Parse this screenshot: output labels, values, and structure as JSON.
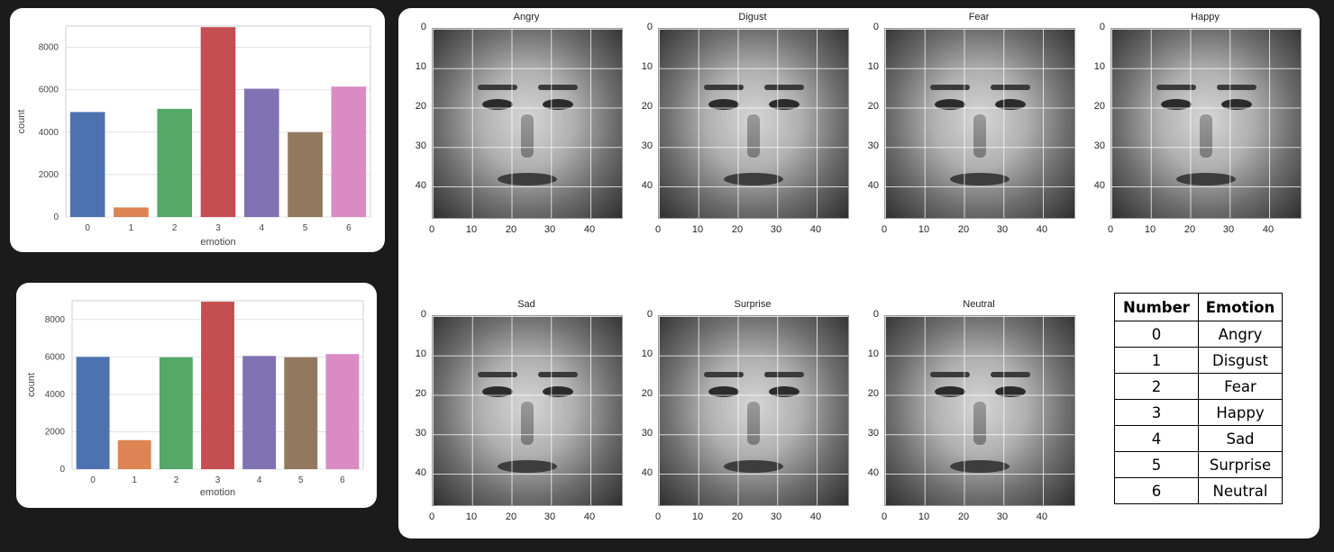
{
  "chart_data": [
    {
      "type": "bar",
      "categories": [
        "0",
        "1",
        "2",
        "3",
        "4",
        "5",
        "6"
      ],
      "values": [
        4950,
        450,
        5100,
        8950,
        6050,
        4000,
        6150
      ],
      "xlabel": "emotion",
      "ylabel": "count",
      "ylim": [
        0,
        9000
      ],
      "yticks": [
        "0",
        "2000",
        "4000",
        "6000",
        "8000"
      ],
      "grid": true,
      "colors": [
        "#4c72b0",
        "#dd8452",
        "#55a868",
        "#c44e52",
        "#8172b3",
        "#937860",
        "#da8bc3"
      ]
    },
    {
      "type": "bar",
      "categories": [
        "0",
        "1",
        "2",
        "3",
        "4",
        "5",
        "6"
      ],
      "values": [
        6000,
        1550,
        5980,
        8950,
        6050,
        5980,
        6150
      ],
      "xlabel": "emotion",
      "ylabel": "count",
      "ylim": [
        0,
        9000
      ],
      "yticks": [
        "0",
        "2000",
        "4000",
        "6000",
        "8000"
      ],
      "grid": true,
      "colors": [
        "#4c72b0",
        "#dd8452",
        "#55a868",
        "#c44e52",
        "#8172b3",
        "#937860",
        "#da8bc3"
      ]
    }
  ],
  "faces": {
    "titles": [
      "Angry",
      "Digust",
      "Fear",
      "Happy",
      "Sad",
      "Surprise",
      "Neutral"
    ],
    "yticks": [
      "0",
      "10",
      "20",
      "30",
      "40"
    ],
    "xticks": [
      "0",
      "10",
      "20",
      "30",
      "40"
    ]
  },
  "legend_table": {
    "headers": [
      "Number",
      "Emotion"
    ],
    "rows": [
      [
        "0",
        "Angry"
      ],
      [
        "1",
        "Disgust"
      ],
      [
        "2",
        "Fear"
      ],
      [
        "3",
        "Happy"
      ],
      [
        "4",
        "Sad"
      ],
      [
        "5",
        "Surprise"
      ],
      [
        "6",
        "Neutral"
      ]
    ]
  }
}
